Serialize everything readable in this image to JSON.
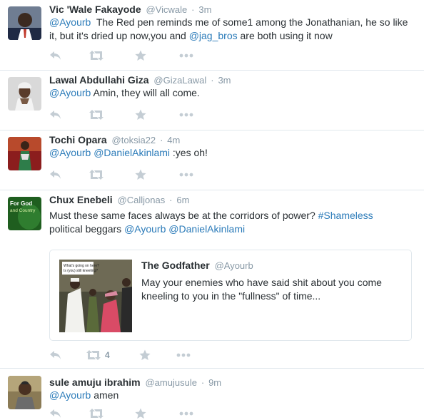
{
  "tweets": [
    {
      "fullname": "Vic 'Wale Fakayode",
      "handle": "@Vicwale",
      "time": "3m",
      "text": [
        {
          "t": "@Ayourb",
          "link": true
        },
        {
          "t": "  The Red pen reminds me of some1 among the Jonathanian, he so like it, but it's dried up now,you and ",
          "link": false
        },
        {
          "t": "@jag_bros",
          "link": true
        },
        {
          "t": " are both using it now",
          "link": false
        }
      ]
    },
    {
      "fullname": "Lawal Abdullahi Giza",
      "handle": "@GizaLawal",
      "time": "3m",
      "text": [
        {
          "t": "@Ayourb",
          "link": true
        },
        {
          "t": " Amin, they will all come.",
          "link": false
        }
      ]
    },
    {
      "fullname": "Tochi Opara",
      "handle": "@toksia22",
      "time": "4m",
      "text": [
        {
          "t": "@Ayourb",
          "link": true
        },
        {
          "t": " ",
          "link": false
        },
        {
          "t": "@DanielAkinlami",
          "link": true
        },
        {
          "t": " :yes oh!",
          "link": false
        }
      ]
    },
    {
      "fullname": "Chux Enebeli",
      "handle": "@Calljonas",
      "time": "6m",
      "avatar_text": [
        "For God",
        "and Country"
      ],
      "text_line1": [
        {
          "t": "Must these same faces always be at the corridors of power? ",
          "link": false
        },
        {
          "t": "#Shameless",
          "link": true
        }
      ],
      "text_line2": [
        {
          "t": "political beggars ",
          "link": false
        },
        {
          "t": "@Ayourb",
          "link": true
        },
        {
          "t": " ",
          "link": false
        },
        {
          "t": "@DanielAkinlami",
          "link": true
        }
      ],
      "quote": {
        "fullname": "The Godfather",
        "handle": "@Ayourb",
        "text": "May your enemies who have said shit about you come kneeling to you in the \"fullness\" of time...",
        "thumb_caption": [
          "What's going on here?",
          "Is (you) still kneeling?"
        ]
      },
      "retweet_count": "4"
    },
    {
      "fullname": "sule amuju ibrahim",
      "handle": "@amujusule",
      "time": "9m",
      "text": [
        {
          "t": "@Ayourb",
          "link": true
        },
        {
          "t": " amen",
          "link": false
        }
      ]
    }
  ],
  "separator": "·",
  "icons": {
    "reply": "reply-icon",
    "retweet": "retweet-icon",
    "favorite": "star-icon",
    "more": "more-icon"
  },
  "colors": {
    "link": "#2b7bb9",
    "muted": "#8899a6",
    "action": "#c4cdd4",
    "border": "#e1e8ed",
    "text": "#292f33"
  }
}
